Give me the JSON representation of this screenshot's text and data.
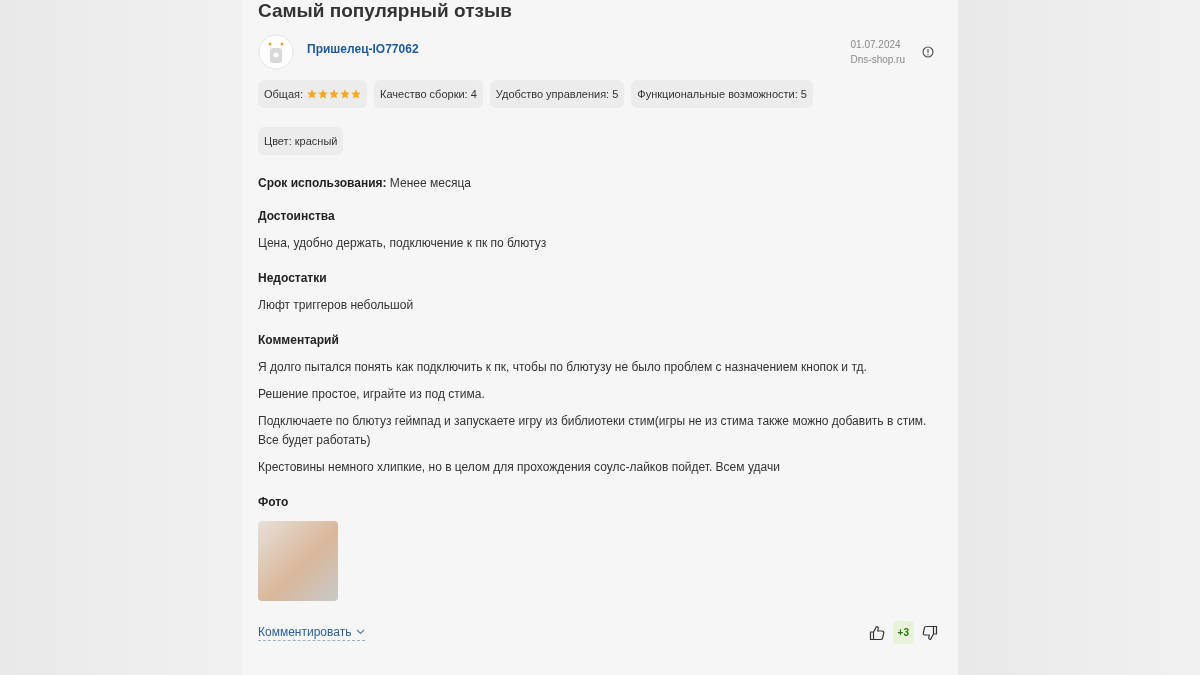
{
  "title": "Самый популярный отзыв",
  "author": {
    "name": "Пришелец-IO77062",
    "date": "01.07.2024",
    "source": "Dns-shop.ru"
  },
  "ratings": [
    {
      "kind": "stars",
      "label": "Общая:",
      "stars": 5
    },
    {
      "kind": "text",
      "label": "Качество сборки: 4"
    },
    {
      "kind": "text",
      "label": "Удобство управления: 5"
    },
    {
      "kind": "text",
      "label": "Функциональные возможности: 5"
    }
  ],
  "color_tag": "Цвет: красный",
  "usage": {
    "label": "Срок использования:",
    "value": "Менее месяца"
  },
  "sections": [
    {
      "heading": "Достоинства",
      "paragraphs": [
        "Цена, удобно держать, подключение к пк по блютуз"
      ]
    },
    {
      "heading": "Недостатки",
      "paragraphs": [
        "Люфт триггеров небольшой"
      ]
    },
    {
      "heading": "Комментарий",
      "paragraphs": [
        "Я долго пытался понять как подключить к пк, чтобы по блютузу не было проблем с назначением кнопок и тд.",
        "Решение простое, играйте из под стима.",
        "Подключаете по блютуз геймпад и запускаете игру из библиотеки стим(игры не из стима также можно добавить в стим. Все будет работать)",
        "Крестовины немного хлипкие, но в целом для прохождения соулс-лайков пойдет. Всем удачи"
      ]
    }
  ],
  "photos": {
    "heading": "Фото"
  },
  "footer": {
    "comment_link": "Комментировать",
    "score": "+3"
  }
}
